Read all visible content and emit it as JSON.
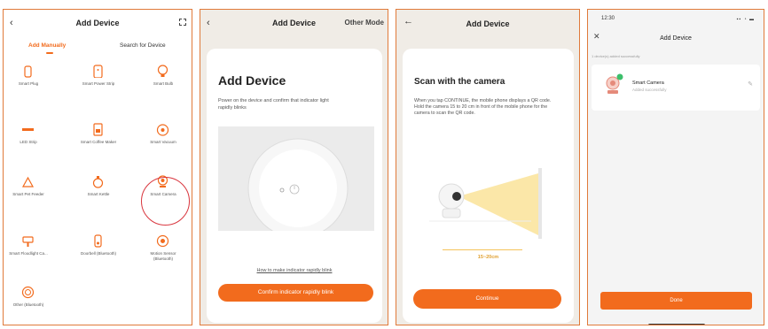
{
  "panel1": {
    "title": "Add Device",
    "tabs": [
      "Add Manually",
      "Search for Device"
    ],
    "devices": [
      {
        "label": "Smart Plug",
        "icon": "plug-icon"
      },
      {
        "label": "Smart Power Strip",
        "icon": "power-strip-icon"
      },
      {
        "label": "Smart Bulb",
        "icon": "bulb-icon"
      },
      {
        "label": "LED Strip",
        "icon": "led-strip-icon"
      },
      {
        "label": "Smart Coffee Maker",
        "icon": "coffee-maker-icon"
      },
      {
        "label": "Smart Vacuum",
        "icon": "vacuum-icon"
      },
      {
        "label": "Smart Pet Feeder",
        "icon": "pet-feeder-icon"
      },
      {
        "label": "Smart Kettle",
        "icon": "kettle-icon"
      },
      {
        "label": "Smart Camera",
        "icon": "camera-icon"
      },
      {
        "label": "Smart Floodlight Ca...",
        "icon": "floodlight-icon"
      },
      {
        "label": "Doorbell (Bluetooth)",
        "icon": "doorbell-icon"
      },
      {
        "label": "Motion Sensor (Bluetooth)",
        "icon": "motion-sensor-icon"
      },
      {
        "label": "Other (Bluetooth)",
        "icon": "bluetooth-device-icon"
      }
    ],
    "colors": {
      "accent": "#f26b1d",
      "highlight": "#d9363e"
    }
  },
  "panel2": {
    "title": "Add Device",
    "other_mode": "Other Mode",
    "heading": "Add Device",
    "instruction": "Power on the device and confirm that indicator light rapidly blinks",
    "help_link": "How to make indicator rapidly blink",
    "confirm_button": "Confirm indicator rapidly blink"
  },
  "panel3": {
    "title": "Add Device",
    "heading": "Scan with the camera",
    "instruction": "When you tap CONTINUE, the mobile phone displays a QR code. Hold the camera 15 to 20 cm in front of the mobile phone for the camera to scan the QR code.",
    "distance": "15~20cm",
    "continue_button": "Continue"
  },
  "panel4": {
    "time": "12:30",
    "title": "Add Device",
    "status": "1 device(s) added successfully",
    "device_name": "Smart Camera",
    "device_status": "Added successfully",
    "done_button": "Done"
  }
}
